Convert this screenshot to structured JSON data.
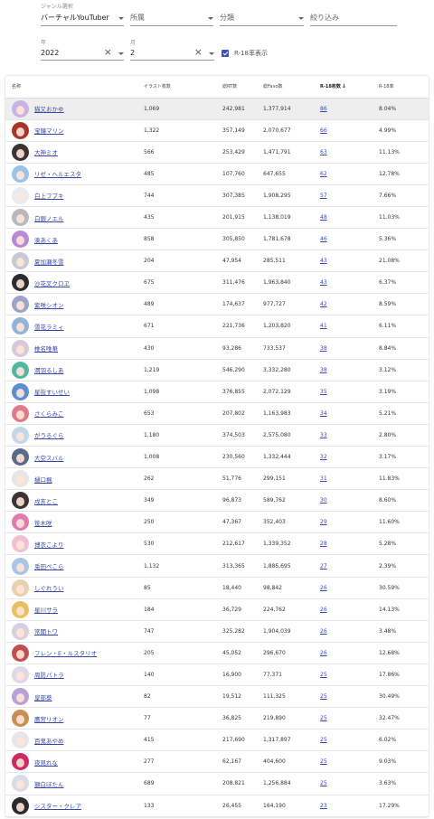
{
  "filters": {
    "genre_label": "ジャンル選択",
    "genre_value": "バーチャルYouTuber",
    "affiliation_placeholder": "所属",
    "category_placeholder": "分類",
    "narrow_placeholder": "絞り込み",
    "year_label": "年",
    "year_value": "2022",
    "month_label": "月",
    "month_value": "2",
    "r18_toggle_label": "R-18率表示",
    "r18_toggle_checked": true
  },
  "table": {
    "headers": [
      "名称",
      "イラスト枚数",
      "総RT数",
      "総Favo数",
      "R-18枚数",
      "R-18率"
    ],
    "sort_column": "R-18枚数",
    "rows": [
      {
        "name": "猫又おかゆ",
        "illustrations": "1,069",
        "rt": "242,981",
        "fav": "1,377,914",
        "r18": "86",
        "rate": "8.04%",
        "color": "#c9b3e6"
      },
      {
        "name": "宝鐘マリン",
        "illustrations": "1,322",
        "rt": "357,149",
        "fav": "2,070,677",
        "r18": "66",
        "rate": "4.99%",
        "color": "#a8342c"
      },
      {
        "name": "大神ミオ",
        "illustrations": "566",
        "rt": "253,429",
        "fav": "1,471,791",
        "r18": "63",
        "rate": "11.13%",
        "color": "#3d3232"
      },
      {
        "name": "リゼ・ヘルエスタ",
        "illustrations": "485",
        "rt": "107,760",
        "fav": "647,655",
        "r18": "62",
        "rate": "12.78%",
        "color": "#9ac3e8"
      },
      {
        "name": "白上フブキ",
        "illustrations": "744",
        "rt": "307,385",
        "fav": "1,908,295",
        "r18": "57",
        "rate": "7.66%",
        "color": "#e6ecf2"
      },
      {
        "name": "白銀ノエル",
        "illustrations": "435",
        "rt": "201,915",
        "fav": "1,138,019",
        "r18": "48",
        "rate": "11.03%",
        "color": "#b8b8c0"
      },
      {
        "name": "湊あくあ",
        "illustrations": "858",
        "rt": "305,850",
        "fav": "1,781,678",
        "r18": "46",
        "rate": "5.36%",
        "color": "#b98ad6"
      },
      {
        "name": "夏加瀬冬雪",
        "illustrations": "204",
        "rt": "47,954",
        "fav": "285,511",
        "r18": "43",
        "rate": "21.08%",
        "color": "#c7c9d6"
      },
      {
        "name": "沙花叉クロヱ",
        "illustrations": "675",
        "rt": "311,476",
        "fav": "1,963,840",
        "r18": "43",
        "rate": "6.37%",
        "color": "#2c2c30"
      },
      {
        "name": "紫咲シオン",
        "illustrations": "489",
        "rt": "174,637",
        "fav": "977,727",
        "r18": "42",
        "rate": "8.59%",
        "color": "#9aa3c8"
      },
      {
        "name": "雪花ラミィ",
        "illustrations": "671",
        "rt": "221,736",
        "fav": "1,203,820",
        "r18": "41",
        "rate": "6.11%",
        "color": "#8fb4d8"
      },
      {
        "name": "椎名唯華",
        "illustrations": "430",
        "rt": "93,286",
        "fav": "733,537",
        "r18": "38",
        "rate": "8.84%",
        "color": "#d8c8d8"
      },
      {
        "name": "潤羽るしあ",
        "illustrations": "1,219",
        "rt": "546,290",
        "fav": "3,332,280",
        "r18": "38",
        "rate": "3.12%",
        "color": "#4fb8a0"
      },
      {
        "name": "星街すいせい",
        "illustrations": "1,098",
        "rt": "376,855",
        "fav": "2,072,129",
        "r18": "35",
        "rate": "3.19%",
        "color": "#5a8fd0"
      },
      {
        "name": "さくらみこ",
        "illustrations": "653",
        "rt": "207,802",
        "fav": "1,163,983",
        "r18": "34",
        "rate": "5.21%",
        "color": "#e07a8a"
      },
      {
        "name": "がうるぐら",
        "illustrations": "1,180",
        "rt": "374,503",
        "fav": "2,575,080",
        "r18": "33",
        "rate": "2.80%",
        "color": "#c0d8ec"
      },
      {
        "name": "大空スバル",
        "illustrations": "1,008",
        "rt": "230,560",
        "fav": "1,332,444",
        "r18": "32",
        "rate": "3.17%",
        "color": "#5a6a88"
      },
      {
        "name": "樋口楓",
        "illustrations": "262",
        "rt": "51,776",
        "fav": "299,151",
        "r18": "31",
        "rate": "11.83%",
        "color": "#e8e4e8"
      },
      {
        "name": "戌亥とこ",
        "illustrations": "349",
        "rt": "96,873",
        "fav": "589,762",
        "r18": "30",
        "rate": "8.60%",
        "color": "#3a3436"
      },
      {
        "name": "笹木咲",
        "illustrations": "250",
        "rt": "47,367",
        "fav": "352,403",
        "r18": "29",
        "rate": "11.60%",
        "color": "#e07ab0"
      },
      {
        "name": "博衣こより",
        "illustrations": "530",
        "rt": "212,617",
        "fav": "1,339,352",
        "r18": "28",
        "rate": "5.28%",
        "color": "#f0c0d0"
      },
      {
        "name": "兎田ぺこら",
        "illustrations": "1,132",
        "rt": "313,365",
        "fav": "1,885,695",
        "r18": "27",
        "rate": "2.39%",
        "color": "#a8c4e8"
      },
      {
        "name": "しぐれうい",
        "illustrations": "85",
        "rt": "18,440",
        "fav": "98,842",
        "r18": "26",
        "rate": "30.59%",
        "color": "#e8d0b0"
      },
      {
        "name": "星川サラ",
        "illustrations": "184",
        "rt": "36,729",
        "fav": "224,762",
        "r18": "26",
        "rate": "14.13%",
        "color": "#e8c060"
      },
      {
        "name": "常闇トワ",
        "illustrations": "747",
        "rt": "325,282",
        "fav": "1,904,039",
        "r18": "26",
        "rate": "3.48%",
        "color": "#d8d0e0"
      },
      {
        "name": "フレン・E・ルスタリオ",
        "illustrations": "205",
        "rt": "45,052",
        "fav": "296,670",
        "r18": "26",
        "rate": "12.68%",
        "color": "#c05050"
      },
      {
        "name": "周防パトラ",
        "illustrations": "140",
        "rt": "16,900",
        "fav": "77,371",
        "r18": "25",
        "rate": "17.86%",
        "color": "#e0d8e8"
      },
      {
        "name": "皇部葵",
        "illustrations": "82",
        "rt": "19,512",
        "fav": "111,325",
        "r18": "25",
        "rate": "30.49%",
        "color": "#b8a0d8"
      },
      {
        "name": "鷹宮リオン",
        "illustrations": "77",
        "rt": "36,825",
        "fav": "219,890",
        "r18": "25",
        "rate": "32.47%",
        "color": "#c89050"
      },
      {
        "name": "百鬼あやめ",
        "illustrations": "415",
        "rt": "217,690",
        "fav": "1,317,897",
        "r18": "25",
        "rate": "6.02%",
        "color": "#e8e4ec"
      },
      {
        "name": "夜見れな",
        "illustrations": "277",
        "rt": "62,167",
        "fav": "404,600",
        "r18": "25",
        "rate": "9.03%",
        "color": "#d02860"
      },
      {
        "name": "獅白ぼたん",
        "illustrations": "689",
        "rt": "208,821",
        "fav": "1,256,884",
        "r18": "25",
        "rate": "3.63%",
        "color": "#d8dce8"
      },
      {
        "name": "シスター・クレア",
        "illustrations": "133",
        "rt": "26,455",
        "fav": "164,190",
        "r18": "23",
        "rate": "17.29%",
        "color": "#2a2a2e"
      }
    ]
  }
}
